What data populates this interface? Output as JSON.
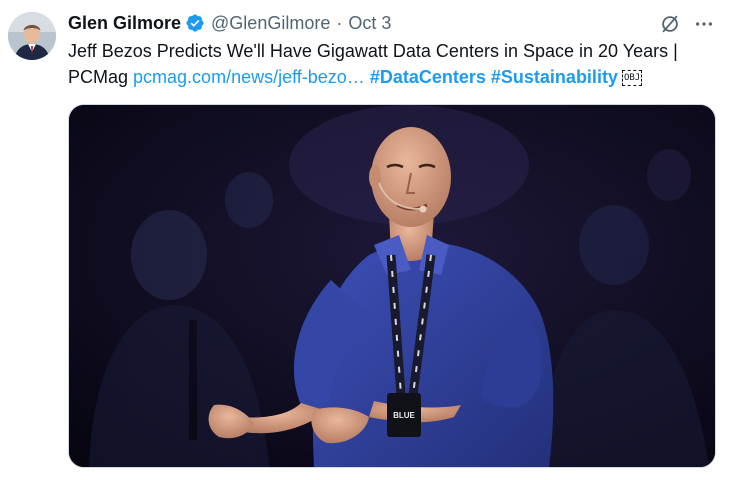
{
  "tweet": {
    "author_name": "Glen Gilmore",
    "handle": "@GlenGilmore",
    "separator": "·",
    "timestamp": "Oct 3",
    "text_part1": "Jeff Bezos Predicts We'll Have Gigawatt Data Centers in Space in 20 Years | PCMag ",
    "link": "pcmag.com/news/jeff-bezo…",
    "hashtags": [
      "#DataCenters",
      "#Sustainability"
    ],
    "obj_glyph": "OBJ",
    "colors": {
      "link": "#1d9bf0",
      "verified": "#1d9bf0",
      "secondary_text": "#536471"
    }
  },
  "icons": {
    "verified": "verified-badge-icon",
    "grok": "grok-icon",
    "more": "more-options-icon"
  },
  "media": {
    "lanyard_text": "BLUE ORIGIN",
    "badge_text": "BLUE"
  }
}
